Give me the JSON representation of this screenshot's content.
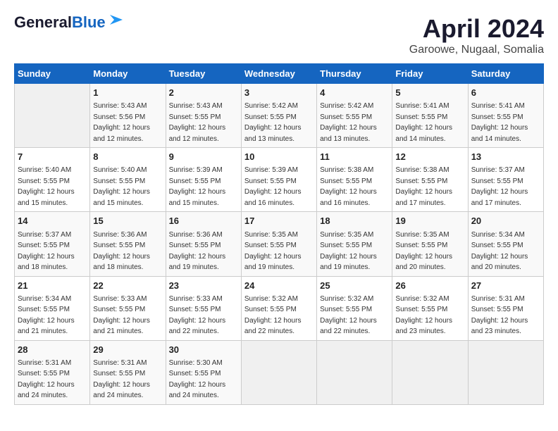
{
  "header": {
    "logo_general": "General",
    "logo_blue": "Blue",
    "month_title": "April 2024",
    "location": "Garoowe, Nugaal, Somalia"
  },
  "days_of_week": [
    "Sunday",
    "Monday",
    "Tuesday",
    "Wednesday",
    "Thursday",
    "Friday",
    "Saturday"
  ],
  "weeks": [
    [
      {
        "day": "",
        "info": ""
      },
      {
        "day": "1",
        "info": "Sunrise: 5:43 AM\nSunset: 5:56 PM\nDaylight: 12 hours\nand 12 minutes."
      },
      {
        "day": "2",
        "info": "Sunrise: 5:43 AM\nSunset: 5:55 PM\nDaylight: 12 hours\nand 12 minutes."
      },
      {
        "day": "3",
        "info": "Sunrise: 5:42 AM\nSunset: 5:55 PM\nDaylight: 12 hours\nand 13 minutes."
      },
      {
        "day": "4",
        "info": "Sunrise: 5:42 AM\nSunset: 5:55 PM\nDaylight: 12 hours\nand 13 minutes."
      },
      {
        "day": "5",
        "info": "Sunrise: 5:41 AM\nSunset: 5:55 PM\nDaylight: 12 hours\nand 14 minutes."
      },
      {
        "day": "6",
        "info": "Sunrise: 5:41 AM\nSunset: 5:55 PM\nDaylight: 12 hours\nand 14 minutes."
      }
    ],
    [
      {
        "day": "7",
        "info": "Sunrise: 5:40 AM\nSunset: 5:55 PM\nDaylight: 12 hours\nand 15 minutes."
      },
      {
        "day": "8",
        "info": "Sunrise: 5:40 AM\nSunset: 5:55 PM\nDaylight: 12 hours\nand 15 minutes."
      },
      {
        "day": "9",
        "info": "Sunrise: 5:39 AM\nSunset: 5:55 PM\nDaylight: 12 hours\nand 15 minutes."
      },
      {
        "day": "10",
        "info": "Sunrise: 5:39 AM\nSunset: 5:55 PM\nDaylight: 12 hours\nand 16 minutes."
      },
      {
        "day": "11",
        "info": "Sunrise: 5:38 AM\nSunset: 5:55 PM\nDaylight: 12 hours\nand 16 minutes."
      },
      {
        "day": "12",
        "info": "Sunrise: 5:38 AM\nSunset: 5:55 PM\nDaylight: 12 hours\nand 17 minutes."
      },
      {
        "day": "13",
        "info": "Sunrise: 5:37 AM\nSunset: 5:55 PM\nDaylight: 12 hours\nand 17 minutes."
      }
    ],
    [
      {
        "day": "14",
        "info": "Sunrise: 5:37 AM\nSunset: 5:55 PM\nDaylight: 12 hours\nand 18 minutes."
      },
      {
        "day": "15",
        "info": "Sunrise: 5:36 AM\nSunset: 5:55 PM\nDaylight: 12 hours\nand 18 minutes."
      },
      {
        "day": "16",
        "info": "Sunrise: 5:36 AM\nSunset: 5:55 PM\nDaylight: 12 hours\nand 19 minutes."
      },
      {
        "day": "17",
        "info": "Sunrise: 5:35 AM\nSunset: 5:55 PM\nDaylight: 12 hours\nand 19 minutes."
      },
      {
        "day": "18",
        "info": "Sunrise: 5:35 AM\nSunset: 5:55 PM\nDaylight: 12 hours\nand 19 minutes."
      },
      {
        "day": "19",
        "info": "Sunrise: 5:35 AM\nSunset: 5:55 PM\nDaylight: 12 hours\nand 20 minutes."
      },
      {
        "day": "20",
        "info": "Sunrise: 5:34 AM\nSunset: 5:55 PM\nDaylight: 12 hours\nand 20 minutes."
      }
    ],
    [
      {
        "day": "21",
        "info": "Sunrise: 5:34 AM\nSunset: 5:55 PM\nDaylight: 12 hours\nand 21 minutes."
      },
      {
        "day": "22",
        "info": "Sunrise: 5:33 AM\nSunset: 5:55 PM\nDaylight: 12 hours\nand 21 minutes."
      },
      {
        "day": "23",
        "info": "Sunrise: 5:33 AM\nSunset: 5:55 PM\nDaylight: 12 hours\nand 22 minutes."
      },
      {
        "day": "24",
        "info": "Sunrise: 5:32 AM\nSunset: 5:55 PM\nDaylight: 12 hours\nand 22 minutes."
      },
      {
        "day": "25",
        "info": "Sunrise: 5:32 AM\nSunset: 5:55 PM\nDaylight: 12 hours\nand 22 minutes."
      },
      {
        "day": "26",
        "info": "Sunrise: 5:32 AM\nSunset: 5:55 PM\nDaylight: 12 hours\nand 23 minutes."
      },
      {
        "day": "27",
        "info": "Sunrise: 5:31 AM\nSunset: 5:55 PM\nDaylight: 12 hours\nand 23 minutes."
      }
    ],
    [
      {
        "day": "28",
        "info": "Sunrise: 5:31 AM\nSunset: 5:55 PM\nDaylight: 12 hours\nand 24 minutes."
      },
      {
        "day": "29",
        "info": "Sunrise: 5:31 AM\nSunset: 5:55 PM\nDaylight: 12 hours\nand 24 minutes."
      },
      {
        "day": "30",
        "info": "Sunrise: 5:30 AM\nSunset: 5:55 PM\nDaylight: 12 hours\nand 24 minutes."
      },
      {
        "day": "",
        "info": ""
      },
      {
        "day": "",
        "info": ""
      },
      {
        "day": "",
        "info": ""
      },
      {
        "day": "",
        "info": ""
      }
    ]
  ]
}
